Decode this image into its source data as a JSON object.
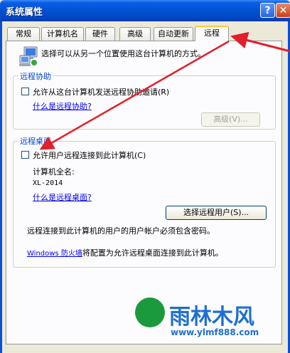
{
  "window": {
    "title": "系统属性",
    "help_glyph": "?",
    "close_glyph": "✕"
  },
  "tabs": [
    {
      "label": "常规"
    },
    {
      "label": "计算机名"
    },
    {
      "label": "硬件"
    },
    {
      "label": "高级"
    },
    {
      "label": "自动更新"
    },
    {
      "label": "远程"
    }
  ],
  "intro": {
    "text": "选择可以从另一个位置使用这台计算机的方式。"
  },
  "remote_assistance": {
    "title": "远程协助",
    "checkbox_label": "允许从这台计算机发送远程协助邀请(R)",
    "checked": false,
    "link": "什么是远程协助?",
    "advanced_button": "高级(V)..."
  },
  "remote_desktop": {
    "title": "远程桌面",
    "checkbox_label": "允许用户远程连接到此计算机(C)",
    "checked": false,
    "computer_name_label": "计算机全名:",
    "computer_name_value": "XL-2014",
    "link": "什么是远程桌面?",
    "select_users_button": "选择远程用户(S)...",
    "note": "远程连接到此计算机的用户的用户帐户必须包含密码。",
    "firewall_link": "Windows 防火墙",
    "firewall_text": "将配置为允许远程桌面连接到此计算机。"
  },
  "watermark": {
    "brand": "雨林木风",
    "url": "www.ylmf888.com"
  },
  "colors": {
    "titlebar": "#0354d8",
    "group_title": "#0046d5",
    "arrow": "#e0202a",
    "watermark": "#1f6fd0"
  }
}
